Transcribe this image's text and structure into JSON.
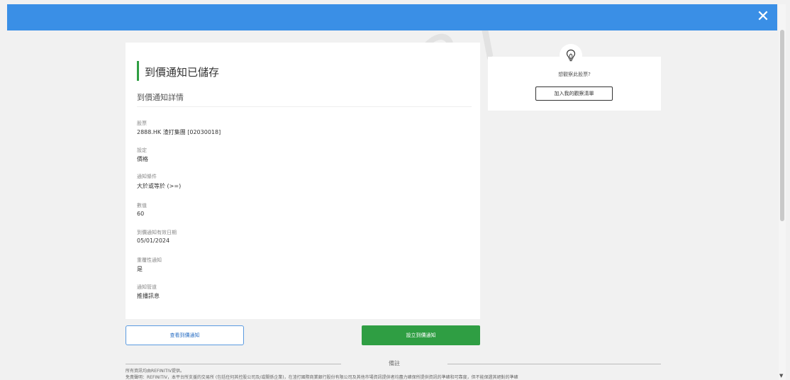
{
  "header": {
    "close_glyph": "✕"
  },
  "card": {
    "title": "到價通知已儲存",
    "subtitle": "到價通知詳情",
    "fields": [
      {
        "label": "股票",
        "value": "2888.HK 渣打集團 [02030018]"
      },
      {
        "label": "設定",
        "value": "價格"
      },
      {
        "label": "通知條件",
        "value": "大於或等於 (>=)"
      },
      {
        "label": "數值",
        "value": "60"
      },
      {
        "label": "到價通知有效日期",
        "value": "05/01/2024"
      },
      {
        "label": "重覆性通知",
        "value": "是"
      },
      {
        "label": "通知管道",
        "value": "推播訊息"
      }
    ]
  },
  "side": {
    "icon": "lightbulb-icon",
    "question": "想觀察此股票?",
    "button_label": "加入我的觀察清單"
  },
  "actions": {
    "view_label": "查看到價通知",
    "create_label": "設立到價通知"
  },
  "remarks": {
    "title": "備註",
    "line1": "所有資訊均由REFINITIV提供。",
    "line2": "免責聲明：REFINITIV，本平台所支援的交易所 (包括任何其控股公司及/或關係企業)，在渣打國際商業銀行股份有限公司及其他市場資訊提供者均盡力確保所提供資訊的準確和可靠度，但不能保證其絕對的準確"
  },
  "watermark": "2012937",
  "colors": {
    "topbar": "#3a8fe6",
    "accent": "#2f9e43",
    "outline": "#5a9ae0"
  }
}
